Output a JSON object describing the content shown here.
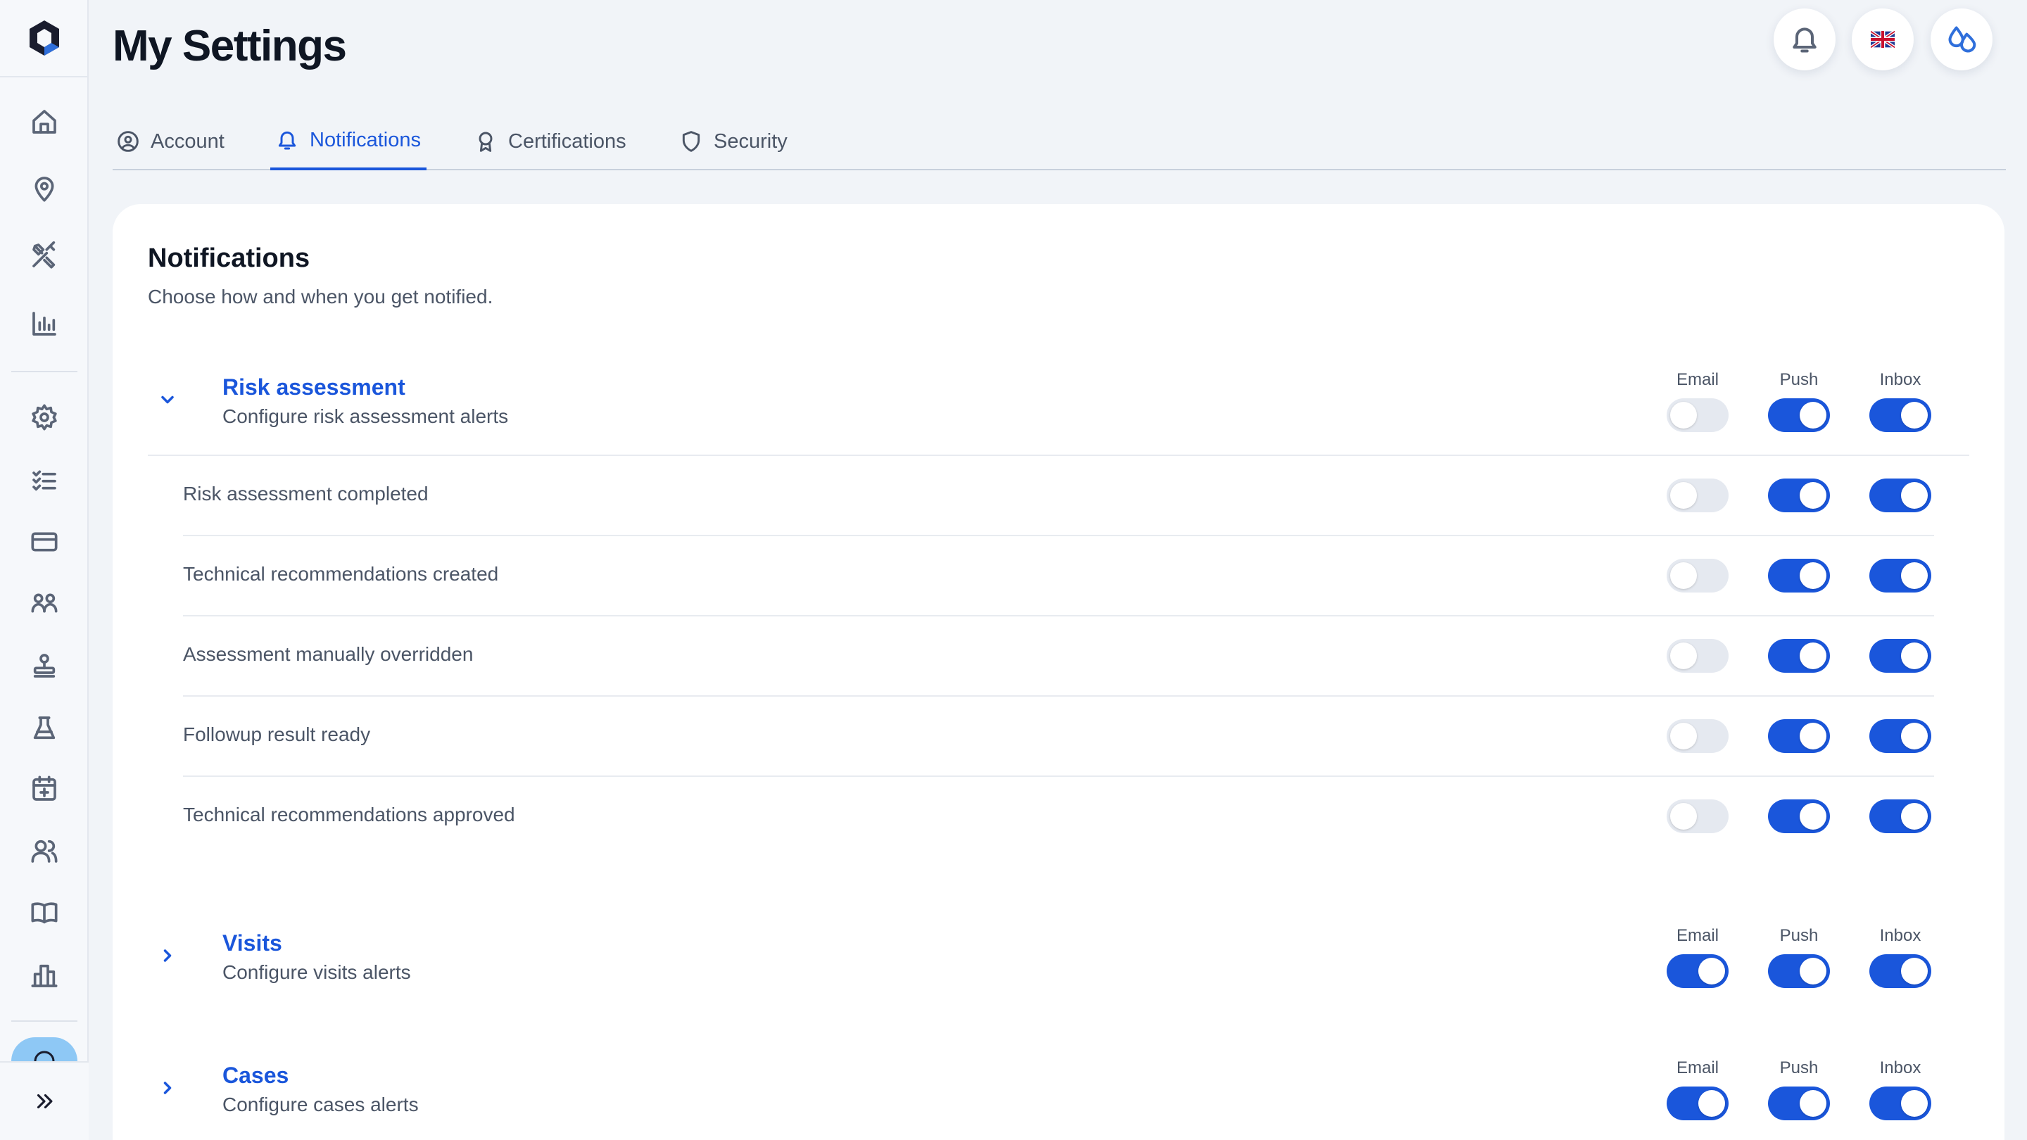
{
  "header": {
    "title": "My Settings",
    "language_flag": "🇬🇧"
  },
  "sidebar": {
    "items": [
      {
        "icon": "home-icon"
      },
      {
        "icon": "map-pin-icon"
      },
      {
        "icon": "tools-icon"
      },
      {
        "icon": "bar-chart-icon"
      },
      {
        "icon": "gear-icon"
      },
      {
        "icon": "checklist-icon"
      },
      {
        "icon": "credit-card-icon"
      },
      {
        "icon": "groups-icon"
      },
      {
        "icon": "stamp-icon"
      },
      {
        "icon": "flask-icon"
      },
      {
        "icon": "calendar-plus-icon"
      },
      {
        "icon": "users-icon"
      },
      {
        "icon": "book-icon"
      },
      {
        "icon": "building-chart-icon"
      }
    ],
    "expand_icon": "double-chevron-right-icon"
  },
  "tabs": [
    {
      "label": "Account",
      "icon": "user-circle-icon",
      "active": false
    },
    {
      "label": "Notifications",
      "icon": "bell-icon",
      "active": true
    },
    {
      "label": "Certifications",
      "icon": "award-icon",
      "active": false
    },
    {
      "label": "Security",
      "icon": "shield-icon",
      "active": false
    }
  ],
  "card": {
    "title": "Notifications",
    "subtitle": "Choose how and when you get notified."
  },
  "columns": {
    "email": "Email",
    "push": "Push",
    "inbox": "Inbox"
  },
  "groups": [
    {
      "title": "Risk assessment",
      "subtitle": "Configure risk assessment alerts",
      "expanded": true,
      "email": false,
      "push": true,
      "inbox": true,
      "items": [
        {
          "label": "Risk assessment completed",
          "email": false,
          "push": true,
          "inbox": true
        },
        {
          "label": "Technical recommendations created",
          "email": false,
          "push": true,
          "inbox": true
        },
        {
          "label": "Assessment manually overridden",
          "email": false,
          "push": true,
          "inbox": true
        },
        {
          "label": "Followup result ready",
          "email": false,
          "push": true,
          "inbox": true
        },
        {
          "label": "Technical recommendations approved",
          "email": false,
          "push": true,
          "inbox": true
        }
      ]
    },
    {
      "title": "Visits",
      "subtitle": "Configure visits alerts",
      "expanded": false,
      "email": true,
      "push": true,
      "inbox": true
    },
    {
      "title": "Cases",
      "subtitle": "Configure cases alerts",
      "expanded": false,
      "email": true,
      "push": true,
      "inbox": true
    }
  ],
  "colors": {
    "accent": "#1a56db",
    "toggle_off": "#e5e9f0",
    "background": "#f1f4f8"
  }
}
